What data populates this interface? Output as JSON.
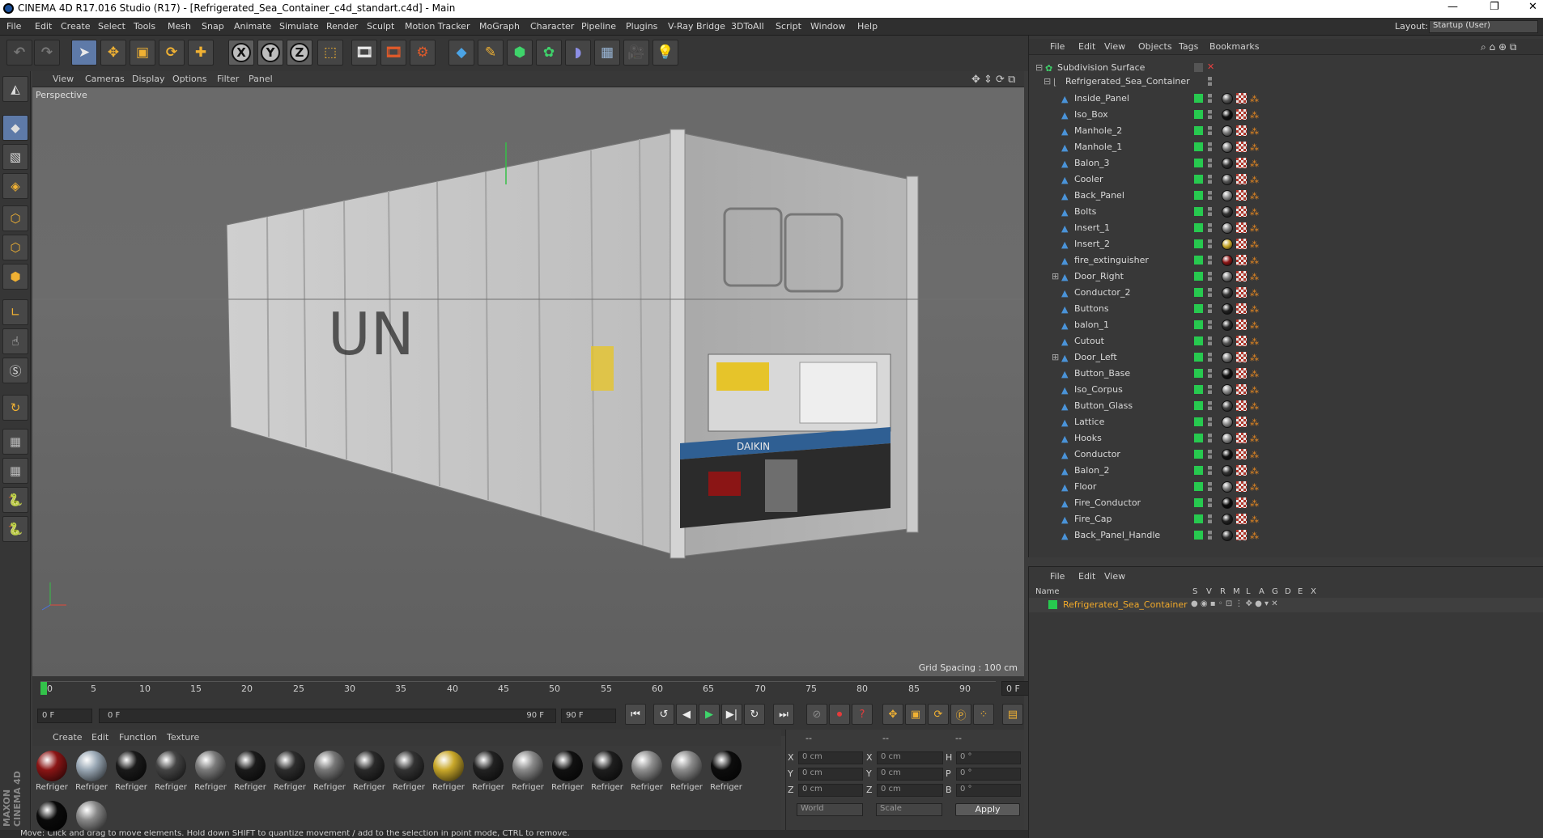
{
  "app": {
    "title": "CINEMA 4D R17.016 Studio (R17) - [Refrigerated_Sea_Container_c4d_standart.c4d] - Main",
    "window_controls": [
      "—",
      "❐",
      "✕"
    ]
  },
  "menu": [
    "File",
    "Edit",
    "Create",
    "Select",
    "Tools",
    "Mesh",
    "Snap",
    "Animate",
    "Simulate",
    "Render",
    "Sculpt",
    "Motion Tracker",
    "MoGraph",
    "Character",
    "Pipeline",
    "Plugins",
    "V-Ray Bridge",
    "3DToAll",
    "Script",
    "Window",
    "Help"
  ],
  "layout": {
    "label": "Layout:",
    "value": "Startup (User)"
  },
  "toolbar": {
    "icons": [
      "undo-icon",
      "redo-icon",
      "select-icon",
      "move-icon",
      "scale-icon",
      "rotate-icon",
      "add-icon",
      "x-axis-icon",
      "y-axis-icon",
      "z-axis-icon",
      "coordinate-system-icon",
      "render-view-icon",
      "render-picture-viewer-icon",
      "edit-render-settings-icon",
      "cube-icon",
      "pen-spline-icon",
      "nurbs-icon",
      "array-icon",
      "deformer-icon",
      "floor-icon",
      "camera-icon",
      "light-icon"
    ],
    "x_label": "X",
    "y_label": "Y",
    "z_label": "Z"
  },
  "viewport": {
    "menu": [
      "View",
      "Cameras",
      "Display",
      "Options",
      "Filter",
      "Panel"
    ],
    "label": "Perspective",
    "grid_spacing": "Grid Spacing : 100 cm",
    "container_text": "UN",
    "brand_text": "DAIKIN"
  },
  "timeline": {
    "ticks": [
      "0",
      "5",
      "10",
      "15",
      "20",
      "25",
      "30",
      "35",
      "40",
      "45",
      "50",
      "55",
      "60",
      "65",
      "70",
      "75",
      "80",
      "85",
      "90"
    ],
    "current_frame": "0 F",
    "start_frame": "0 F",
    "range_start": "0 F",
    "range_end": "90 F",
    "end_frame": "90 F"
  },
  "materials": {
    "menu": [
      "Create",
      "Edit",
      "Function",
      "Texture"
    ],
    "label": "Refriger",
    "brand_side": "MAXON CINEMA 4D",
    "items": [
      {
        "color": "#8b1515"
      },
      {
        "color": "#9aa8b5"
      },
      {
        "color": "#1a1a1a"
      },
      {
        "color": "#444444"
      },
      {
        "color": "#7a7a7a"
      },
      {
        "color": "#1b1b1b"
      },
      {
        "color": "#2d2d2d"
      },
      {
        "color": "#777777"
      },
      {
        "color": "#2a2a2a"
      },
      {
        "color": "#333333"
      },
      {
        "color": "#c9a82a"
      },
      {
        "color": "#222222"
      },
      {
        "color": "#8a8a8a"
      },
      {
        "color": "#111111"
      },
      {
        "color": "#1e1e1e"
      },
      {
        "color": "#8f8f8f"
      },
      {
        "color": "#8c8c8c"
      },
      {
        "color": "#0d0d0d"
      },
      {
        "color": "#0a0a0a"
      },
      {
        "color": "#888888"
      }
    ]
  },
  "coords": {
    "headers": [
      "--",
      "--",
      "--"
    ],
    "rows": [
      {
        "a": "X",
        "av": "0 cm",
        "b": "X",
        "bv": "0 cm",
        "c": "H",
        "cv": "0 °"
      },
      {
        "a": "Y",
        "av": "0 cm",
        "b": "Y",
        "bv": "0 cm",
        "c": "P",
        "cv": "0 °"
      },
      {
        "a": "Z",
        "av": "0 cm",
        "b": "Z",
        "bv": "0 cm",
        "c": "B",
        "cv": "0 °"
      }
    ],
    "world": "World",
    "scale": "Scale",
    "apply": "Apply"
  },
  "status": "Move: Click and drag to move elements. Hold down SHIFT to quantize movement / add to the selection in point mode, CTRL to remove.",
  "objects": {
    "menu": [
      "File",
      "Edit",
      "View",
      "Objects",
      "Tags",
      "Bookmarks"
    ],
    "root": "Subdivision Surface",
    "group": "Refrigerated_Sea_Container",
    "items": [
      {
        "name": "Inside_Panel",
        "tag": "#555555"
      },
      {
        "name": "Iso_Box",
        "tag": "#111111"
      },
      {
        "name": "Manhole_2",
        "tag": "#777777"
      },
      {
        "name": "Manhole_1",
        "tag": "#777777"
      },
      {
        "name": "Balon_3",
        "tag": "#333333"
      },
      {
        "name": "Cooler",
        "tag": "#555555"
      },
      {
        "name": "Back_Panel",
        "tag": "#888888"
      },
      {
        "name": "Bolts",
        "tag": "#333333"
      },
      {
        "name": "Insert_1",
        "tag": "#777777"
      },
      {
        "name": "Insert_2",
        "tag": "#c9a82a"
      },
      {
        "name": "fire_extinguisher",
        "tag": "#8b1515"
      },
      {
        "name": "Door_Right",
        "tag": "#777777"
      },
      {
        "name": "Conductor_2",
        "tag": "#333333"
      },
      {
        "name": "Buttons",
        "tag": "#222222"
      },
      {
        "name": "balon_1",
        "tag": "#2a2a2a"
      },
      {
        "name": "Cutout",
        "tag": "#555555"
      },
      {
        "name": "Door_Left",
        "tag": "#777777"
      },
      {
        "name": "Button_Base",
        "tag": "#111111"
      },
      {
        "name": "Iso_Corpus",
        "tag": "#888888"
      },
      {
        "name": "Button_Glass",
        "tag": "#444444"
      },
      {
        "name": "Lattice",
        "tag": "#888888"
      },
      {
        "name": "Hooks",
        "tag": "#888888"
      },
      {
        "name": "Conductor",
        "tag": "#111111"
      },
      {
        "name": "Balon_2",
        "tag": "#333333"
      },
      {
        "name": "Floor",
        "tag": "#777777"
      },
      {
        "name": "Fire_Conductor",
        "tag": "#0d0d0d"
      },
      {
        "name": "Fire_Cap",
        "tag": "#222222"
      },
      {
        "name": "Back_Panel_Handle",
        "tag": "#333333"
      }
    ]
  },
  "attributes": {
    "menu": [
      "File",
      "Edit",
      "View"
    ],
    "columns": [
      "Name",
      "S",
      "V",
      "R",
      "M",
      "L",
      "A",
      "G",
      "D",
      "E",
      "X"
    ],
    "row": "Refrigerated_Sea_Container"
  }
}
